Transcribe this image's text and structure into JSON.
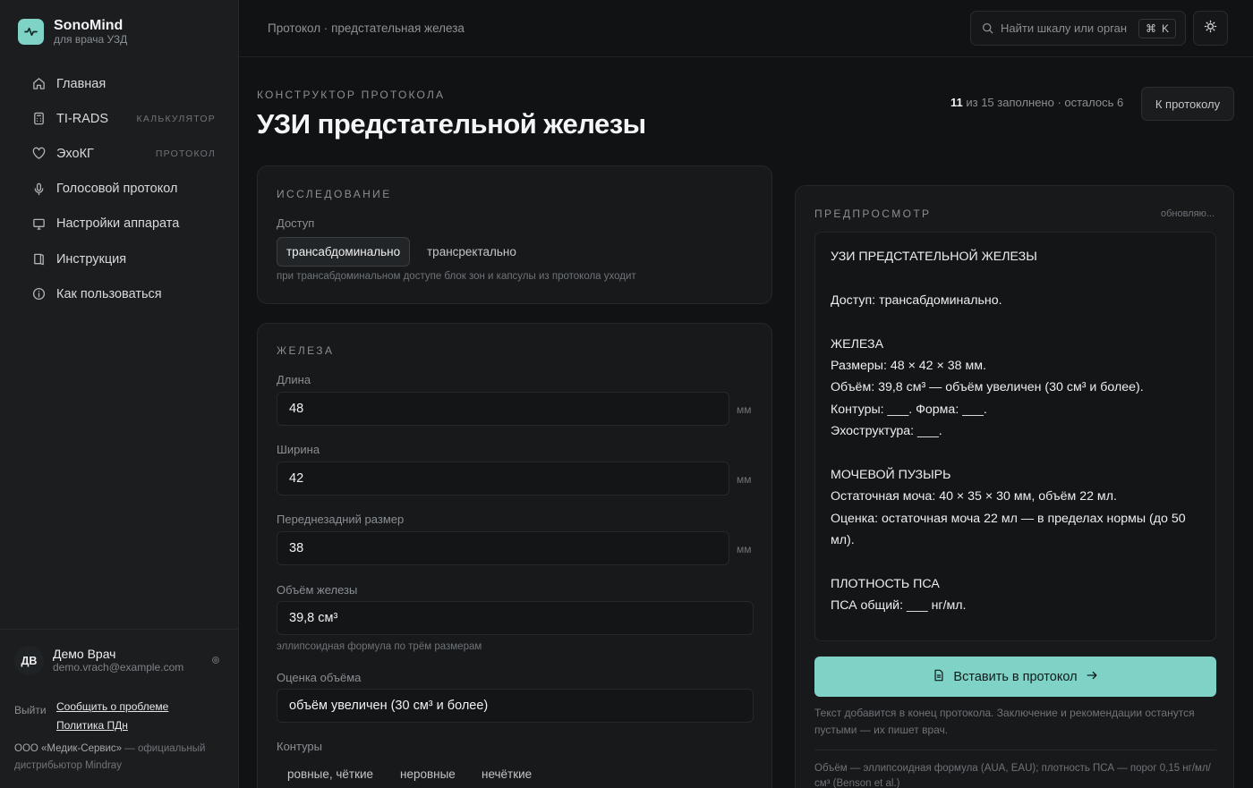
{
  "app": {
    "name": "SonoMind",
    "subtitle": "для врача УЗД"
  },
  "nav": [
    {
      "label": "Главная",
      "icon": "home-icon",
      "badge": ""
    },
    {
      "label": "TI-RADS",
      "icon": "calculator-icon",
      "badge": "КАЛЬКУЛЯТОР"
    },
    {
      "label": "ЭхоКГ",
      "icon": "heart-icon",
      "badge": "ПРОТОКОЛ"
    },
    {
      "label": "Голосовой протокол",
      "icon": "microphone-icon",
      "badge": ""
    },
    {
      "label": "Настройки аппарата",
      "icon": "monitor-icon",
      "badge": ""
    },
    {
      "label": "Инструкция",
      "icon": "book-icon",
      "badge": ""
    },
    {
      "label": "Как пользоваться",
      "icon": "info-icon",
      "badge": ""
    }
  ],
  "user": {
    "initials": "ДВ",
    "name": "Демо Врач",
    "email": "demo.vrach@example.com",
    "logout": "Выйти"
  },
  "footer_links": {
    "report": "Сообщить о проблеме",
    "privacy": "Политика ПДн"
  },
  "company": {
    "name": "ООО «Медик-Сервис»",
    "text": " — официальный дистрибьютор Mindray"
  },
  "topbar": {
    "breadcrumb": "Протокол · предстательная железа",
    "search_placeholder": "Найти шкалу или орган",
    "shortcut_cmd": "⌘",
    "shortcut_key": "K"
  },
  "header": {
    "eyebrow": "КОНСТРУКТОР ПРОТОКОЛА",
    "title": "УЗИ предстательной железы",
    "progress_filled": "11",
    "progress_rest": " из 15 заполнено · осталось 6",
    "to_protocol": "К протоколу"
  },
  "study": {
    "title": "ИССЛЕДОВАНИЕ",
    "access_label": "Доступ",
    "options": [
      "трансабдоминально",
      "трансректально"
    ],
    "selected": "трансабдоминально",
    "hint": "при трансабдоминальном доступе блок зон и капсулы из протокола уходит"
  },
  "gland": {
    "title": "ЖЕЛЕЗА",
    "length_label": "Длина",
    "length_value": "48",
    "width_label": "Ширина",
    "width_value": "42",
    "ap_label": "Переднезадний размер",
    "ap_value": "38",
    "unit": "мм",
    "volume_label": "Объём железы",
    "volume_value": "39,8 см³",
    "volume_hint": "эллипсоидная формула по трём размерам",
    "volume_grade_label": "Оценка объёма",
    "volume_grade_value": "объём увеличен (30 см³ и более)",
    "contours_label": "Контуры",
    "contours_options": [
      "ровные, чёткие",
      "неровные",
      "нечёткие"
    ]
  },
  "preview": {
    "title": "ПРЕДПРОСМОТР",
    "status": "обновляю...",
    "lines": [
      "УЗИ ПРЕДСТАТЕЛЬНОЙ ЖЕЛЕЗЫ",
      "",
      "Доступ: трансабдоминально.",
      "",
      "ЖЕЛЕЗА",
      "Размеры: 48 × 42 × 38 мм.",
      "Объём: 39,8 см³ — объём увеличен (30 см³ и более).",
      "Контуры: ___. Форма: ___.",
      "Эхоструктура: ___.",
      "",
      "МОЧЕВОЙ ПУЗЫРЬ",
      "Остаточная моча: 40 × 35 × 30 мм, объём 22 мл.",
      "Оценка: остаточная моча 22 мл — в пределах нормы (до 50 мл).",
      "",
      "ПЛОТНОСТЬ ПСА",
      "ПСА общий: ___ нг/мл."
    ],
    "insert_button": "Вставить в протокол",
    "note": "Текст добавится в конец протокола. Заключение и рекомендации останутся пустыми — их пишет врач.",
    "footnote": "Объём — эллипсоидная формула (AUA, EAU); плотность ПСА — порог 0,15 нг/мл/см³ (Benson et al.)"
  },
  "colors": {
    "accent": "#7fd3c6",
    "background": "#111213",
    "sidebar": "#1b1d1f",
    "card": "#17191b"
  }
}
